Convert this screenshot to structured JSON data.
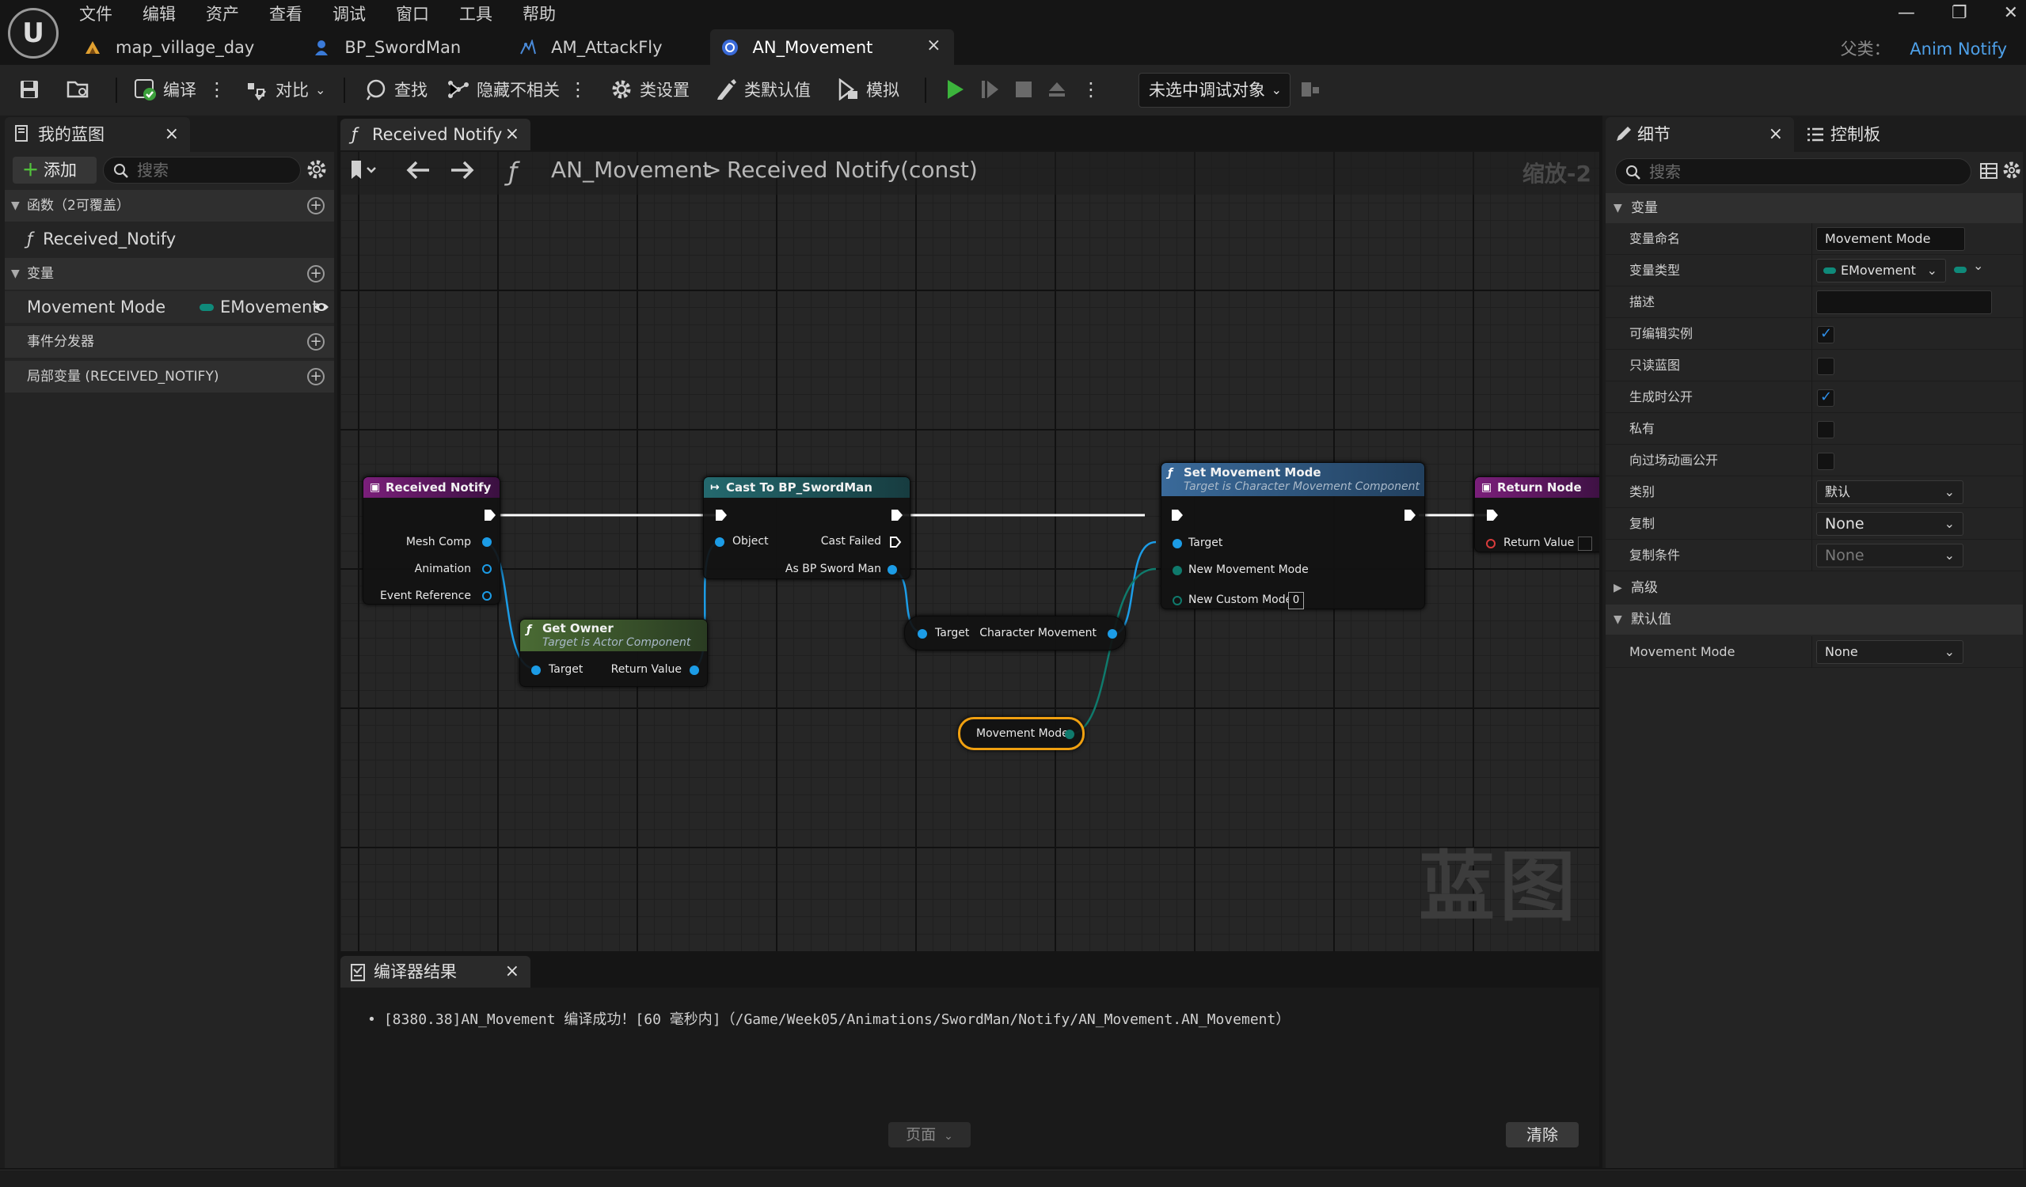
{
  "menu": [
    "文件",
    "编辑",
    "资产",
    "查看",
    "调试",
    "窗口",
    "工具",
    "帮助"
  ],
  "tabs": [
    {
      "label": "map_village_day",
      "icon": "level-icon"
    },
    {
      "label": "BP_SwordMan",
      "icon": "pawn-blueprint-icon"
    },
    {
      "label": "AM_AttackFly",
      "icon": "anim-montage-icon"
    },
    {
      "label": "AN_Movement",
      "icon": "anim-notify-icon",
      "active": true,
      "close": "×"
    }
  ],
  "window_controls": {
    "minimize": "—",
    "restore": "❐",
    "close": "✕"
  },
  "parent_class": {
    "label": "父类：",
    "value": "Anim Notify"
  },
  "toolbar": {
    "compile": "编译",
    "diff": "对比",
    "find": "查找",
    "hide_unrelated": "隐藏不相关",
    "class_settings": "类设置",
    "class_defaults": "类默认值",
    "simulate": "模拟",
    "debug_object": "未选中调试对象"
  },
  "my_blueprint": {
    "tab_label": "我的蓝图",
    "add_label": "添加",
    "search_placeholder": "搜索",
    "functions_header": "函数（2可覆盖）",
    "function_item": "Received_Notify",
    "variables_header": "变量",
    "variable_name": "Movement Mode",
    "variable_type": "EMovement",
    "dispatchers_header": "事件分发器",
    "locals_header": "局部变量 (RECEIVED_NOTIFY)"
  },
  "graph": {
    "tab_label": "Received Notify",
    "breadcrumb_root": "AN_Movement",
    "breadcrumb_sep": ">",
    "breadcrumb_func": "Received Notify(const)",
    "zoom": "缩放-2",
    "watermark": "蓝图",
    "nodes": {
      "received_notify": {
        "title": "Received Notify",
        "pins": [
          "Mesh Comp",
          "Animation",
          "Event Reference"
        ]
      },
      "get_owner": {
        "title": "Get Owner",
        "subtitle": "Target is Actor Component",
        "pins": [
          "Target",
          "Return Value"
        ]
      },
      "cast": {
        "title": "Cast To BP_SwordMan",
        "pins": [
          "Object",
          "Cast Failed",
          "As BP Sword Man"
        ]
      },
      "char_movement": {
        "pins": [
          "Target",
          "Character Movement"
        ]
      },
      "set_movement": {
        "title": "Set Movement Mode",
        "subtitle": "Target is Character Movement Component",
        "pins": [
          "Target",
          "New Movement Mode",
          "New Custom Mode"
        ],
        "custom_mode_value": "0"
      },
      "return_node": {
        "title": "Return Node",
        "pins": [
          "Return Value"
        ]
      },
      "movement_mode_var": {
        "label": "Movement Mode"
      }
    }
  },
  "compiler": {
    "tab_label": "编译器结果",
    "message": "[8380.38]AN_Movement 编译成功！[60 毫秒内]（/Game/Week05/Animations/SwordMan/Notify/AN_Movement.AN_Movement）",
    "page_label": "页面",
    "clear_label": "清除"
  },
  "details": {
    "tab_label": "细节",
    "palette_label": "控制板",
    "search_placeholder": "搜索",
    "variable_section": "变量",
    "rows": {
      "var_name": {
        "label": "变量命名",
        "value": "Movement Mode"
      },
      "var_type": {
        "label": "变量类型",
        "value": "EMovement"
      },
      "description": {
        "label": "描述",
        "value": ""
      },
      "editable": {
        "label": "可编辑实例",
        "checked": true
      },
      "readonly": {
        "label": "只读蓝图",
        "checked": false
      },
      "expose_spawn": {
        "label": "生成时公开",
        "checked": true
      },
      "private": {
        "label": "私有",
        "checked": false
      },
      "expose_cinematics": {
        "label": "向过场动画公开",
        "checked": false
      },
      "category": {
        "label": "类别",
        "value": "默认"
      },
      "replication": {
        "label": "复制",
        "value": "None"
      },
      "rep_condition": {
        "label": "复制条件",
        "value": "None"
      }
    },
    "advanced_section": "高级",
    "defaults_section": "默认值",
    "default_row": {
      "label": "Movement Mode",
      "value": "None"
    }
  },
  "colors": {
    "accent_blue": "#1c9ce6",
    "exec_white": "#ffffff",
    "enum_teal": "#0f7a6c",
    "event_header": "#7a1f7a",
    "pure_header": "#4a6b34",
    "cast_header": "#24696e",
    "function_header": "#3a6a9a",
    "selection_orange": "#f0a010"
  }
}
